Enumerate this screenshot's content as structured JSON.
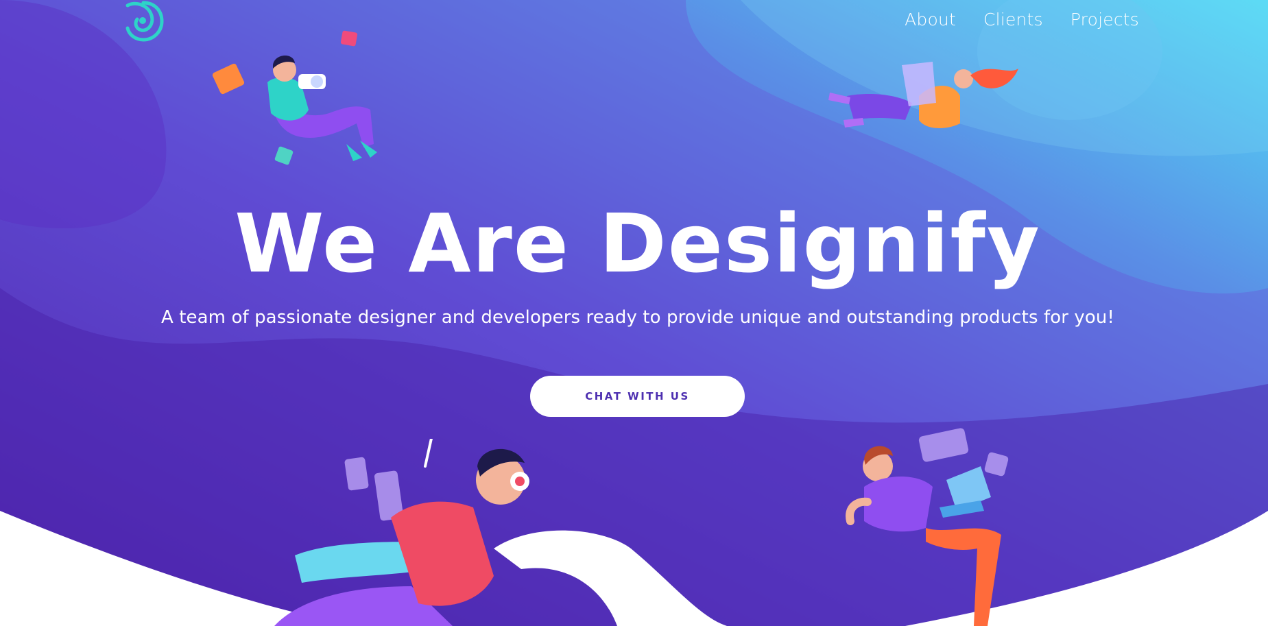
{
  "brand": {
    "logo_icon": "designify-logo-icon",
    "colors": {
      "gradient_start": "#4a18a0",
      "gradient_mid": "#5a55d8",
      "gradient_end": "#4fdaf4",
      "logo": "#2ed3c8",
      "cta_text": "#4d2fb0"
    }
  },
  "nav": {
    "items": [
      {
        "label": "About"
      },
      {
        "label": "Clients"
      },
      {
        "label": "Projects"
      }
    ]
  },
  "hero": {
    "title": "We Are Designify",
    "subtitle": "A team of passionate designer and developers ready to provide unique and outstanding products for you!",
    "cta_label": "CHAT WITH US"
  },
  "illustrations": [
    {
      "name": "photographer-illustration"
    },
    {
      "name": "laptop-woman-illustration"
    },
    {
      "name": "headphones-designer-illustration"
    },
    {
      "name": "developer-illustration"
    }
  ]
}
